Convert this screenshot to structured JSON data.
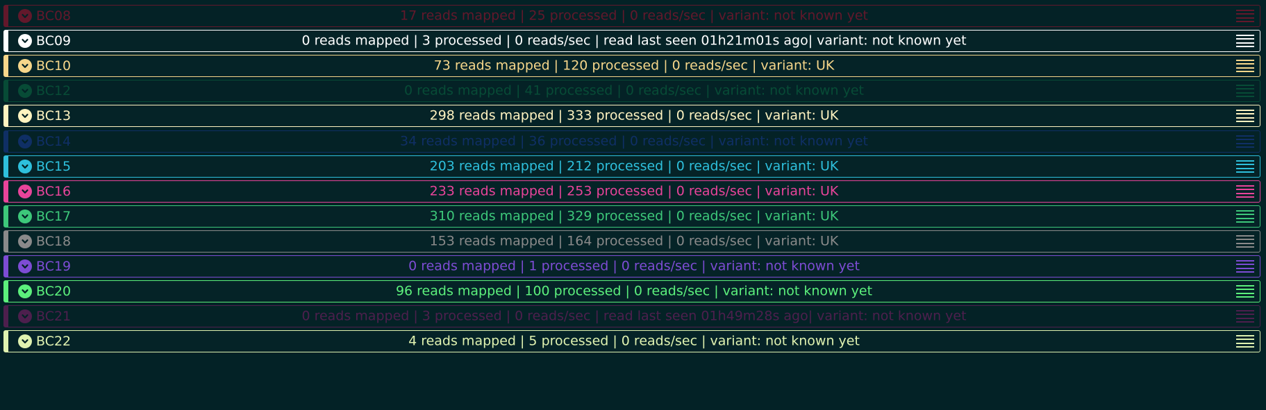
{
  "rows": [
    {
      "barcode": "BC08",
      "stats": "17 reads mapped | 25 processed | 0 reads/sec | variant: not known yet",
      "color": "#b01030",
      "dim": true
    },
    {
      "barcode": "BC09",
      "stats": "0 reads mapped | 3 processed | 0 reads/sec | read last seen 01h21m01s ago| variant: not known yet",
      "color": "#ffffff",
      "dim": false
    },
    {
      "barcode": "BC10",
      "stats": "73 reads mapped | 120 processed | 0 reads/sec | variant: UK",
      "color": "#f6d68a",
      "dim": false
    },
    {
      "barcode": "BC12",
      "stats": "0 reads mapped | 41 processed | 0 reads/sec | variant: not known yet",
      "color": "#0c6e44",
      "dim": true
    },
    {
      "barcode": "BC13",
      "stats": "298 reads mapped | 333 processed | 0 reads/sec | variant: UK",
      "color": "#fff3c0",
      "dim": false
    },
    {
      "barcode": "BC14",
      "stats": "34 reads mapped | 36 processed | 0 reads/sec | variant: not known yet",
      "color": "#1a3a9a",
      "dim": true
    },
    {
      "barcode": "BC15",
      "stats": "203 reads mapped | 212 processed | 0 reads/sec | variant: UK",
      "color": "#2ec0dc",
      "dim": false
    },
    {
      "barcode": "BC16",
      "stats": "233 reads mapped | 253 processed | 0 reads/sec | variant: UK",
      "color": "#e8449a",
      "dim": false
    },
    {
      "barcode": "BC17",
      "stats": "310 reads mapped | 329 processed | 0 reads/sec | variant: UK",
      "color": "#3dc87a",
      "dim": false
    },
    {
      "barcode": "BC18",
      "stats": "153 reads mapped | 164 processed | 0 reads/sec | variant: UK",
      "color": "#8a8a8a",
      "dim": false
    },
    {
      "barcode": "BC19",
      "stats": "0 reads mapped | 1 processed | 0 reads/sec | variant: not known yet",
      "color": "#7d4cd4",
      "dim": false
    },
    {
      "barcode": "BC20",
      "stats": "96 reads mapped | 100 processed | 0 reads/sec | variant: not known yet",
      "color": "#5cf07c",
      "dim": false
    },
    {
      "barcode": "BC21",
      "stats": "0 reads mapped | 3 processed | 0 reads/sec | read last seen 01h49m28s ago| variant: not known yet",
      "color": "#8a1e6e",
      "dim": true
    },
    {
      "barcode": "BC22",
      "stats": "4 reads mapped | 5 processed | 0 reads/sec | variant: not known yet",
      "color": "#e0f2b0",
      "dim": false
    }
  ],
  "icons": {
    "toggle": "chevron-down-icon",
    "menu": "hamburger-menu-icon"
  },
  "background": "#032226"
}
